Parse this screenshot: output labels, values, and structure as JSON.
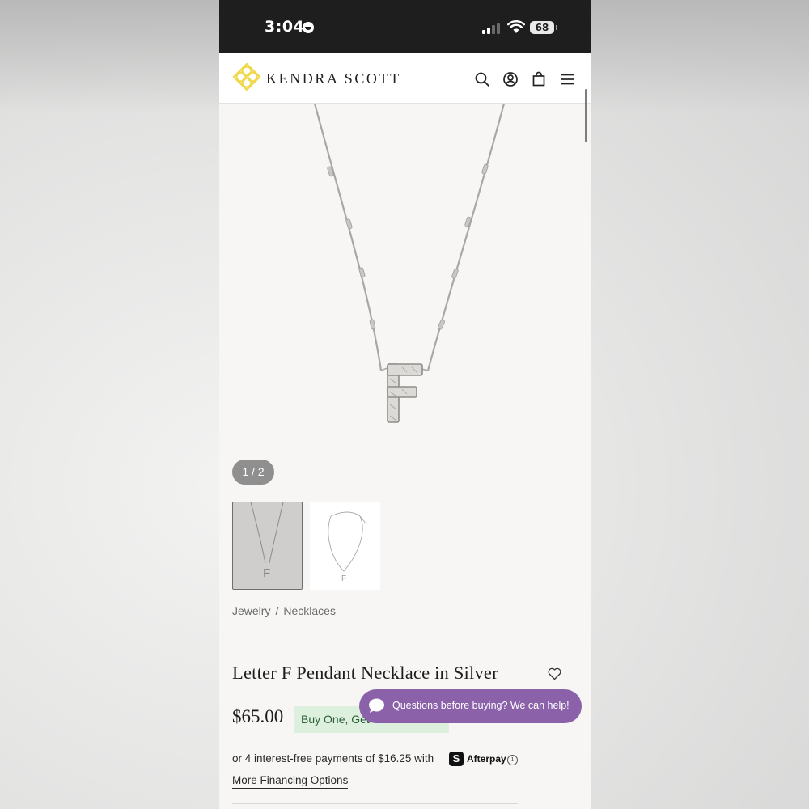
{
  "status_bar": {
    "time": "3:04",
    "battery": "68"
  },
  "header": {
    "brand": "KENDRA SCOTT",
    "icons": [
      "search-icon",
      "account-icon",
      "bag-icon",
      "menu-icon"
    ]
  },
  "gallery": {
    "pager": "1 / 2",
    "thumbnails": [
      "necklace-front",
      "necklace-full"
    ]
  },
  "breadcrumb": {
    "items": [
      "Jewelry",
      "Necklaces"
    ],
    "separator": "/"
  },
  "product": {
    "title": "Letter F Pendant Necklace in Silver",
    "price": "$65.00",
    "promo": "Buy One, Get"
  },
  "chat": {
    "text": "Questions before buying? We can help!"
  },
  "payment": {
    "installments": "or 4 interest-free payments of $16.25 with",
    "provider_icon": "S",
    "provider": "Afterpay",
    "info": "i",
    "financing_link": "More Financing Options"
  },
  "colors": {
    "promo_bg": "#dcf0dd",
    "chat_bg": "#8b61a9",
    "logo": "#f0d84a"
  }
}
